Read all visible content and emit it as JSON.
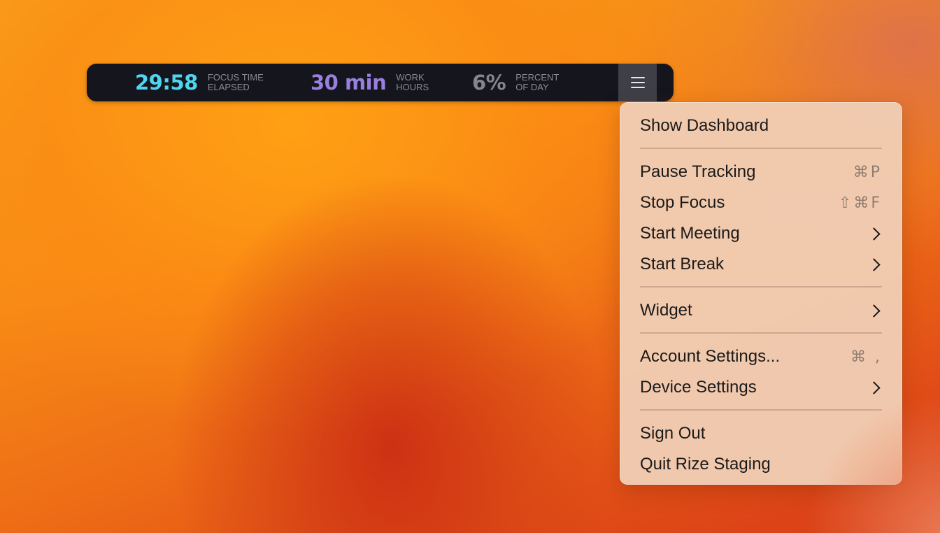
{
  "widget": {
    "stats": [
      {
        "value": "29:58",
        "label_line1": "FOCUS TIME",
        "label_line2": "ELAPSED",
        "color": "#4fd5ee"
      },
      {
        "value": "30 min",
        "label_line1": "WORK",
        "label_line2": "HOURS",
        "color": "#9a80dd"
      },
      {
        "value": "6%",
        "label_line1": "PERCENT",
        "label_line2": "OF DAY",
        "color": "#85858e"
      }
    ],
    "menu_icon": "hamburger-menu-icon"
  },
  "menu": {
    "items": [
      {
        "label": "Show Dashboard"
      },
      {
        "label": "Pause Tracking",
        "shortcut": "⌘P"
      },
      {
        "label": "Stop Focus",
        "shortcut": "⇧⌘F"
      },
      {
        "label": "Start Meeting",
        "submenu": true
      },
      {
        "label": "Start Break",
        "submenu": true
      },
      {
        "label": "Widget",
        "submenu": true
      },
      {
        "label": "Account Settings...",
        "shortcut": "⌘ ,"
      },
      {
        "label": "Device Settings",
        "submenu": true
      },
      {
        "label": "Sign Out"
      },
      {
        "label": "Quit Rize Staging"
      }
    ]
  }
}
